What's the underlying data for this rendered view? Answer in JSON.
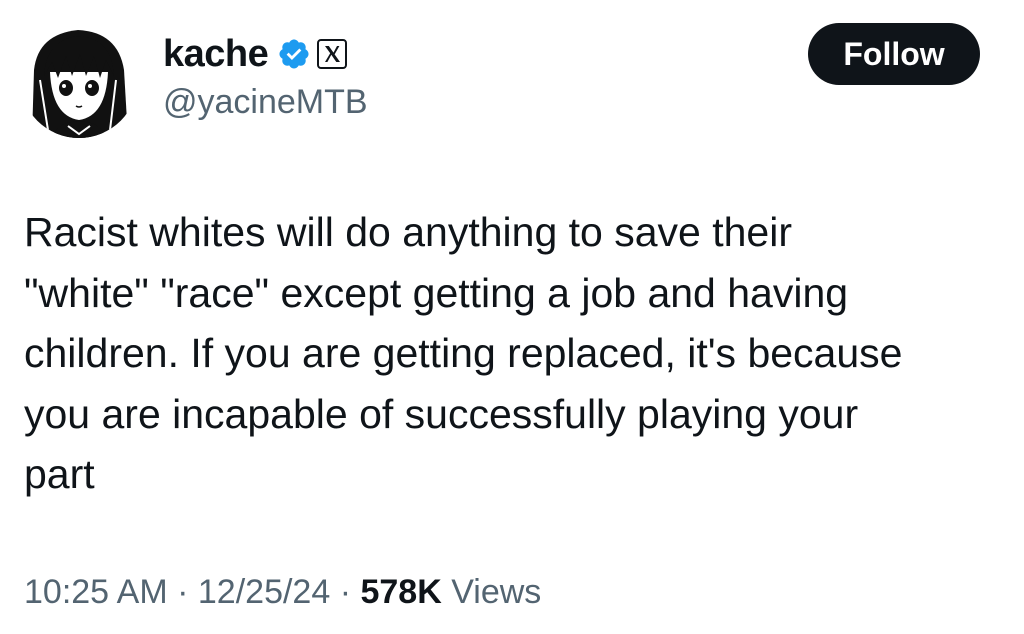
{
  "author": {
    "display_name": "kache",
    "handle": "@yacineMTB",
    "verified": true,
    "verified_color": "#1d9bf0",
    "badge_icon": "x-logo-icon",
    "avatar_icon": "anime-girl-avatar"
  },
  "follow_button": {
    "label": "Follow"
  },
  "tweet": {
    "lines": [
      "Racist whites will do anything to save their",
      "\"white\" \"race\" except getting a job and having",
      "children. If you are getting replaced, it's because",
      "you are incapable of successfully playing your",
      "part"
    ]
  },
  "meta": {
    "time": "10:25 AM",
    "separator": "·",
    "date": "12/25/24",
    "views_count": "578K",
    "views_label": "Views"
  },
  "colors": {
    "text_primary": "#0f1419",
    "text_secondary": "#536471",
    "button_bg": "#0f1419",
    "button_text": "#ffffff"
  }
}
